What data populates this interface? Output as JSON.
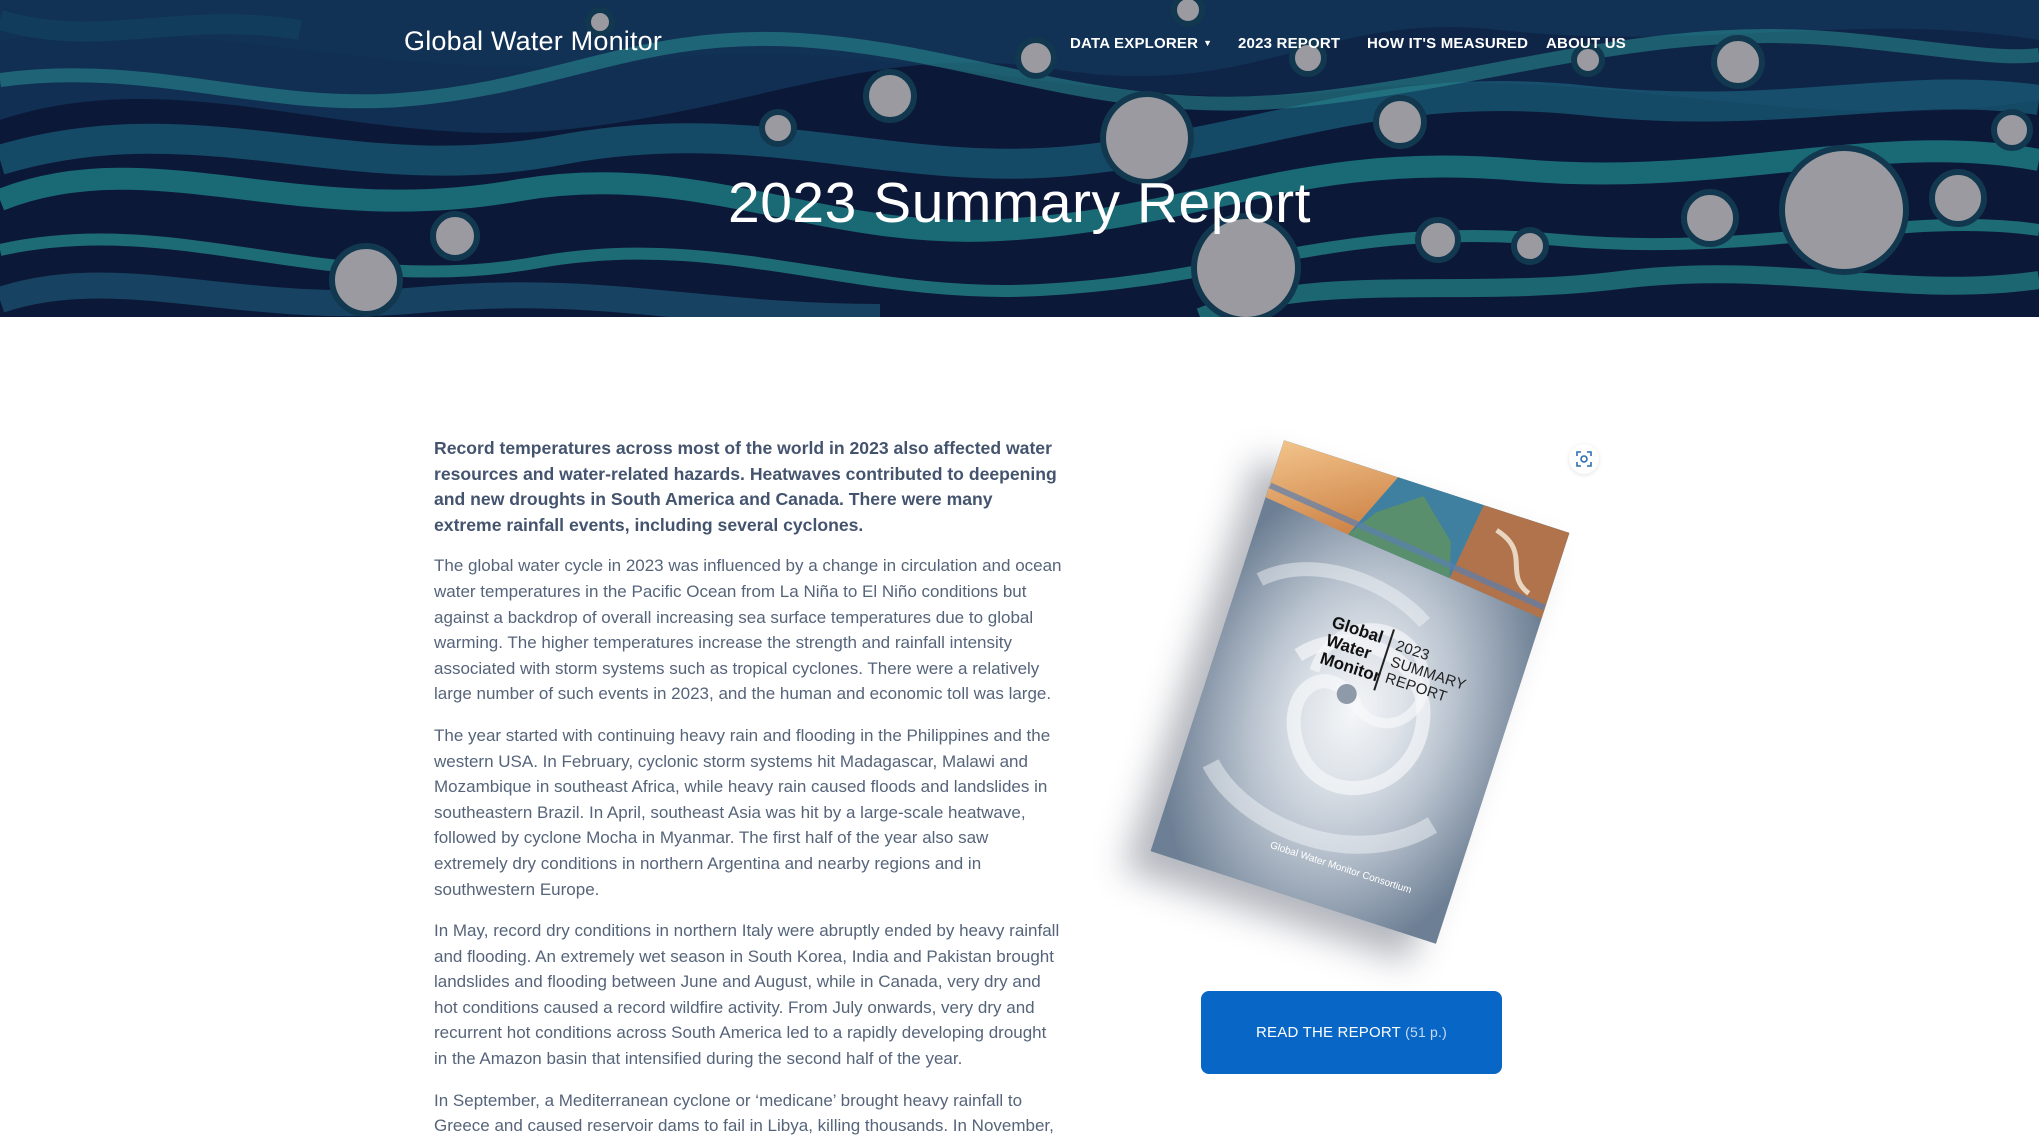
{
  "header": {
    "site_title": "Global Water Monitor",
    "nav": [
      {
        "label": "DATA EXPLORER",
        "has_dropdown": true
      },
      {
        "label": "2023 REPORT"
      },
      {
        "label": "HOW IT'S MEASURED"
      },
      {
        "label": "ABOUT US"
      }
    ]
  },
  "hero": {
    "title": "2023 Summary Report"
  },
  "article": {
    "lead": "Record temperatures across most of the world in 2023 also affected water resources and water-related hazards. Heatwaves contributed to deepening and new droughts in South America and Canada. There were many extreme rainfall events, including several cyclones.",
    "paragraphs": [
      "The global water cycle in 2023 was influenced by a change in circulation and ocean water temperatures in the Pacific Ocean from La Niña to El Niño conditions but against a backdrop of overall increasing sea surface temperatures due to global warming. The higher temperatures increase the strength and rainfall intensity associated with storm systems such as tropical cyclones. There were a relatively large number of such events in 2023, and the human and economic toll was large.",
      "The year started with continuing heavy rain and flooding in the Philippines and the western USA. In February, cyclonic storm systems hit Madagascar, Malawi and Mozambique in southeast Africa, while heavy rain caused floods and landslides in southeastern Brazil. In April, southeast Asia was hit by a large-scale heatwave, followed by cyclone Mocha in Myanmar. The first half of the year also saw extremely dry conditions in northern Argentina and nearby regions and in southwestern Europe.",
      "In May, record dry conditions in northern Italy were abruptly ended by heavy rainfall and flooding. An extremely wet season in South Korea, India and Pakistan brought landslides and flooding between June and August, while in Canada, very dry and hot conditions caused a record wildfire activity. From July onwards, very dry and recurrent hot conditions across South America led to a rapidly developing drought in the Amazon basin that intensified during the second half of the year.",
      "In September, a Mediterranean cyclone or ‘medicane’ brought heavy rainfall to Greece and caused reservoir dams to fail in Libya, killing thousands. In November,"
    ]
  },
  "report_cover": {
    "brand": "Global Water Monitor",
    "brand_lines": [
      "Global",
      "Water",
      "Monitor"
    ],
    "subtitle_lines": [
      "2023",
      "SUMMARY",
      "REPORT"
    ],
    "footer": "Global Water Monitor Consortium",
    "expand_icon": "expand-icon"
  },
  "cta": {
    "label": "READ THE REPORT",
    "pages": "(51 p.)",
    "color": "#0866c6"
  }
}
